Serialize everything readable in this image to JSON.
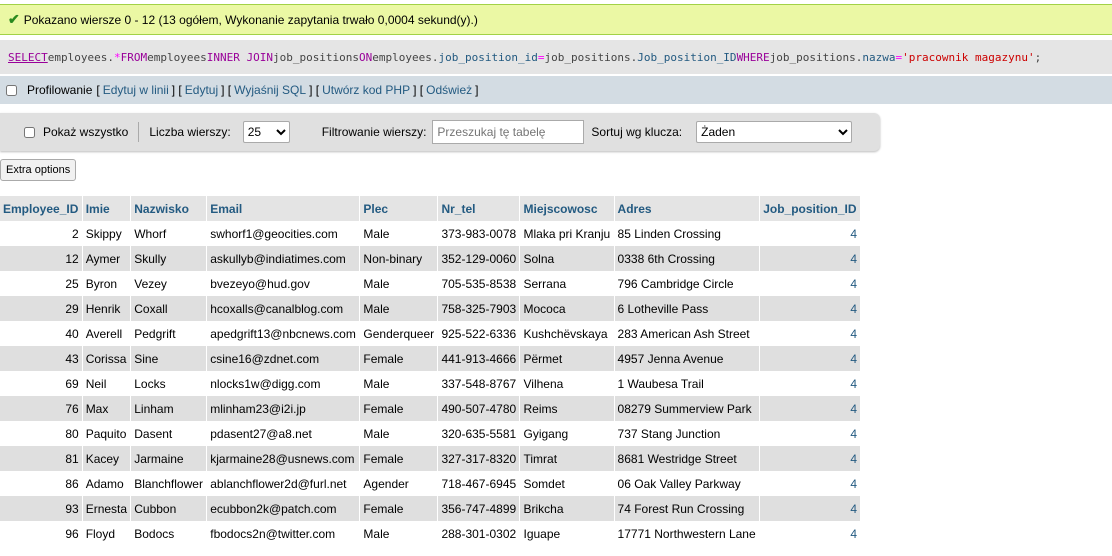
{
  "message": "Pokazano wiersze 0 - 12 (13 ogółem, Wykonanie zapytania trwało 0,0004 sekund(y).)",
  "sql": {
    "select": "SELECT",
    "t1": " employees.",
    "star": "*",
    "from": " FROM",
    "t2": " employees ",
    "inner": "INNER JOIN",
    "t3": " job_positions ",
    "on": "ON",
    "t4": " employees.",
    "f1": "job_position_id",
    "eq1": " = ",
    "t5": "job_positions.",
    "f2": "Job_position_ID",
    "where": " WHERE",
    "t6": " job_positions.",
    "f3": "nazwa",
    "eq2": " = ",
    "str": "'pracownik magazynu'",
    "end": ";"
  },
  "tools": {
    "profiling": "Profilowanie",
    "inline_edit": "Edytuj w linii",
    "edit": "Edytuj",
    "explain": "Wyjaśnij SQL",
    "php": "Utwórz kod PHP",
    "refresh": "Odśwież"
  },
  "nav": {
    "show_all": "Pokaż wszystko",
    "rows_label": "Liczba wierszy:",
    "rows_value": "25",
    "filter_label": "Filtrowanie wierszy:",
    "filter_placeholder": "Przeszukaj tę tabelę",
    "sort_label": "Sortuj wg klucza:",
    "sort_value": "Żaden"
  },
  "extra_options": "Extra options",
  "columns": [
    "Employee_ID",
    "Imie",
    "Nazwisko",
    "Email",
    "Plec",
    "Nr_tel",
    "Miejscowosc",
    "Adres",
    "Job_position_ID"
  ],
  "rows": [
    [
      "2",
      "Skippy",
      "Whorf",
      "swhorf1@geocities.com",
      "Male",
      "373-983-0078",
      "Mlaka pri Kranju",
      "85 Linden Crossing",
      "4"
    ],
    [
      "12",
      "Aymer",
      "Skully",
      "askullyb@indiatimes.com",
      "Non-binary",
      "352-129-0060",
      "Solna",
      "0338 6th Crossing",
      "4"
    ],
    [
      "25",
      "Byron",
      "Vezey",
      "bvezeyo@hud.gov",
      "Male",
      "705-535-8538",
      "Serrana",
      "796 Cambridge Circle",
      "4"
    ],
    [
      "29",
      "Henrik",
      "Coxall",
      "hcoxalls@canalblog.com",
      "Male",
      "758-325-7903",
      "Mococa",
      "6 Lotheville Pass",
      "4"
    ],
    [
      "40",
      "Averell",
      "Pedgrift",
      "apedgrift13@nbcnews.com",
      "Genderqueer",
      "925-522-6336",
      "Kushchëvskaya",
      "283 American Ash Street",
      "4"
    ],
    [
      "43",
      "Corissa",
      "Sine",
      "csine16@zdnet.com",
      "Female",
      "441-913-4666",
      "Përmet",
      "4957 Jenna Avenue",
      "4"
    ],
    [
      "69",
      "Neil",
      "Locks",
      "nlocks1w@digg.com",
      "Male",
      "337-548-8767",
      "Vilhena",
      "1 Waubesa Trail",
      "4"
    ],
    [
      "76",
      "Max",
      "Linham",
      "mlinham23@i2i.jp",
      "Female",
      "490-507-4780",
      "Reims",
      "08279 Summerview Park",
      "4"
    ],
    [
      "80",
      "Paquito",
      "Dasent",
      "pdasent27@a8.net",
      "Male",
      "320-635-5581",
      "Gyigang",
      "737 Stang Junction",
      "4"
    ],
    [
      "81",
      "Kacey",
      "Jarmaine",
      "kjarmaine28@usnews.com",
      "Female",
      "327-317-8320",
      "Timrat",
      "8681 Westridge Street",
      "4"
    ],
    [
      "86",
      "Adamo",
      "Blanchflower",
      "ablanchflower2d@furl.net",
      "Agender",
      "718-467-6945",
      "Somdet",
      "06 Oak Valley Parkway",
      "4"
    ],
    [
      "93",
      "Ernesta",
      "Cubbon",
      "ecubbon2k@patch.com",
      "Female",
      "356-747-4899",
      "Brikcha",
      "74 Forest Run Crossing",
      "4"
    ],
    [
      "96",
      "Floyd",
      "Bodocs",
      "fbodocs2n@twitter.com",
      "Male",
      "288-301-0302",
      "Iguape",
      "17771 Northwestern Lane",
      "4"
    ]
  ]
}
